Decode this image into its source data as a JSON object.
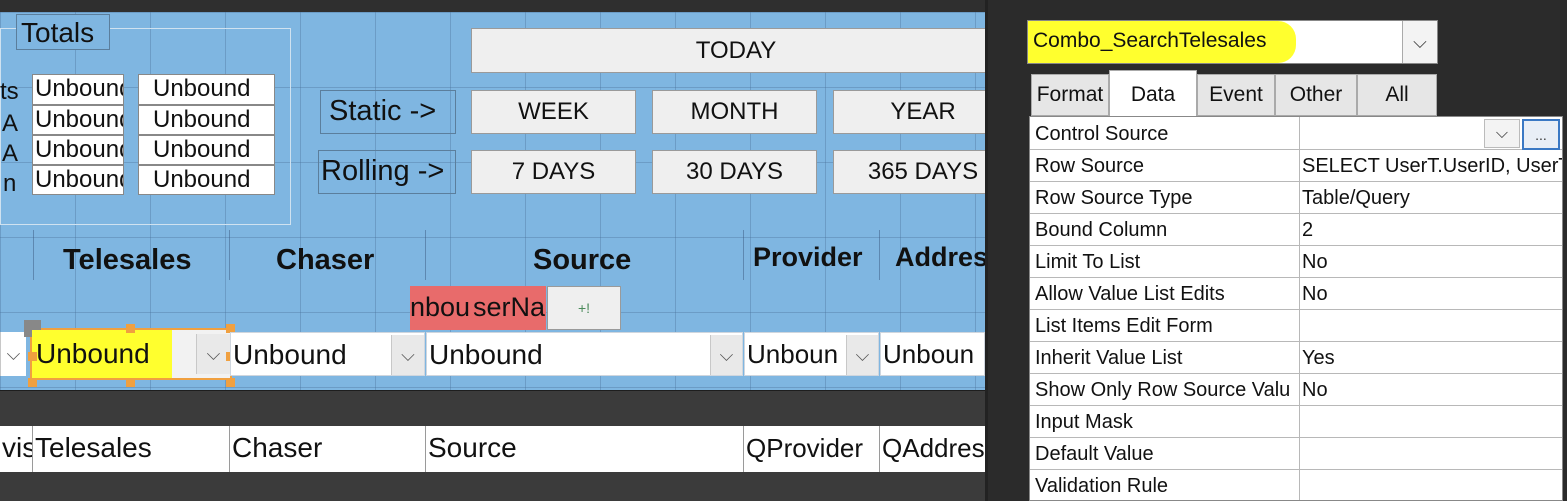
{
  "designer": {
    "totals_label": "Totals",
    "left_partial_labels": [
      "ts",
      "A",
      "A",
      "n"
    ],
    "unbound_col1": [
      "Unbound",
      "Unbound",
      "Unbound",
      "Unbound"
    ],
    "unbound_col2": [
      "Unbound",
      "Unbound",
      "Unbound",
      "Unbound"
    ],
    "static_label": "Static ->",
    "rolling_label": "Rolling ->",
    "buttons": {
      "today": "TODAY",
      "week": "WEEK",
      "month": "MONTH",
      "year": "YEAR",
      "days7": "7 DAYS",
      "days30": "30 DAYS",
      "days365": "365 DAYS"
    },
    "headings": {
      "telesales": "Telesales",
      "chaser": "Chaser",
      "source": "Source",
      "provider": "Provider",
      "address": "Addres"
    },
    "red_box1": "nbou",
    "red_box2": "serNa",
    "small_button": "+!",
    "combos": {
      "telesales": "Unbound",
      "chaser": "Unbound",
      "source": "Unbound",
      "provider": "Unboun",
      "address": "Unboun"
    },
    "detail": [
      "vis",
      "Telesales",
      "Chaser",
      "Source",
      "QProvider",
      "QAddres"
    ]
  },
  "property_sheet": {
    "selected_object": "Combo_SearchTelesales",
    "tabs": [
      "Format",
      "Data",
      "Event",
      "Other",
      "All"
    ],
    "active_tab": "Data",
    "rows": [
      {
        "name": "Control Source",
        "value": ""
      },
      {
        "name": "Row Source",
        "value": "SELECT UserT.UserID, UserT"
      },
      {
        "name": "Row Source Type",
        "value": "Table/Query"
      },
      {
        "name": "Bound Column",
        "value": "2"
      },
      {
        "name": "Limit To List",
        "value": "No"
      },
      {
        "name": "Allow Value List Edits",
        "value": "No"
      },
      {
        "name": "List Items Edit Form",
        "value": ""
      },
      {
        "name": "Inherit Value List",
        "value": "Yes"
      },
      {
        "name": "Show Only Row Source Valu",
        "value": "No"
      },
      {
        "name": "Input Mask",
        "value": ""
      },
      {
        "name": "Default Value",
        "value": ""
      },
      {
        "name": "Validation Rule",
        "value": ""
      }
    ],
    "builder_button": "...",
    "highlight_color": "#ffff2e"
  }
}
